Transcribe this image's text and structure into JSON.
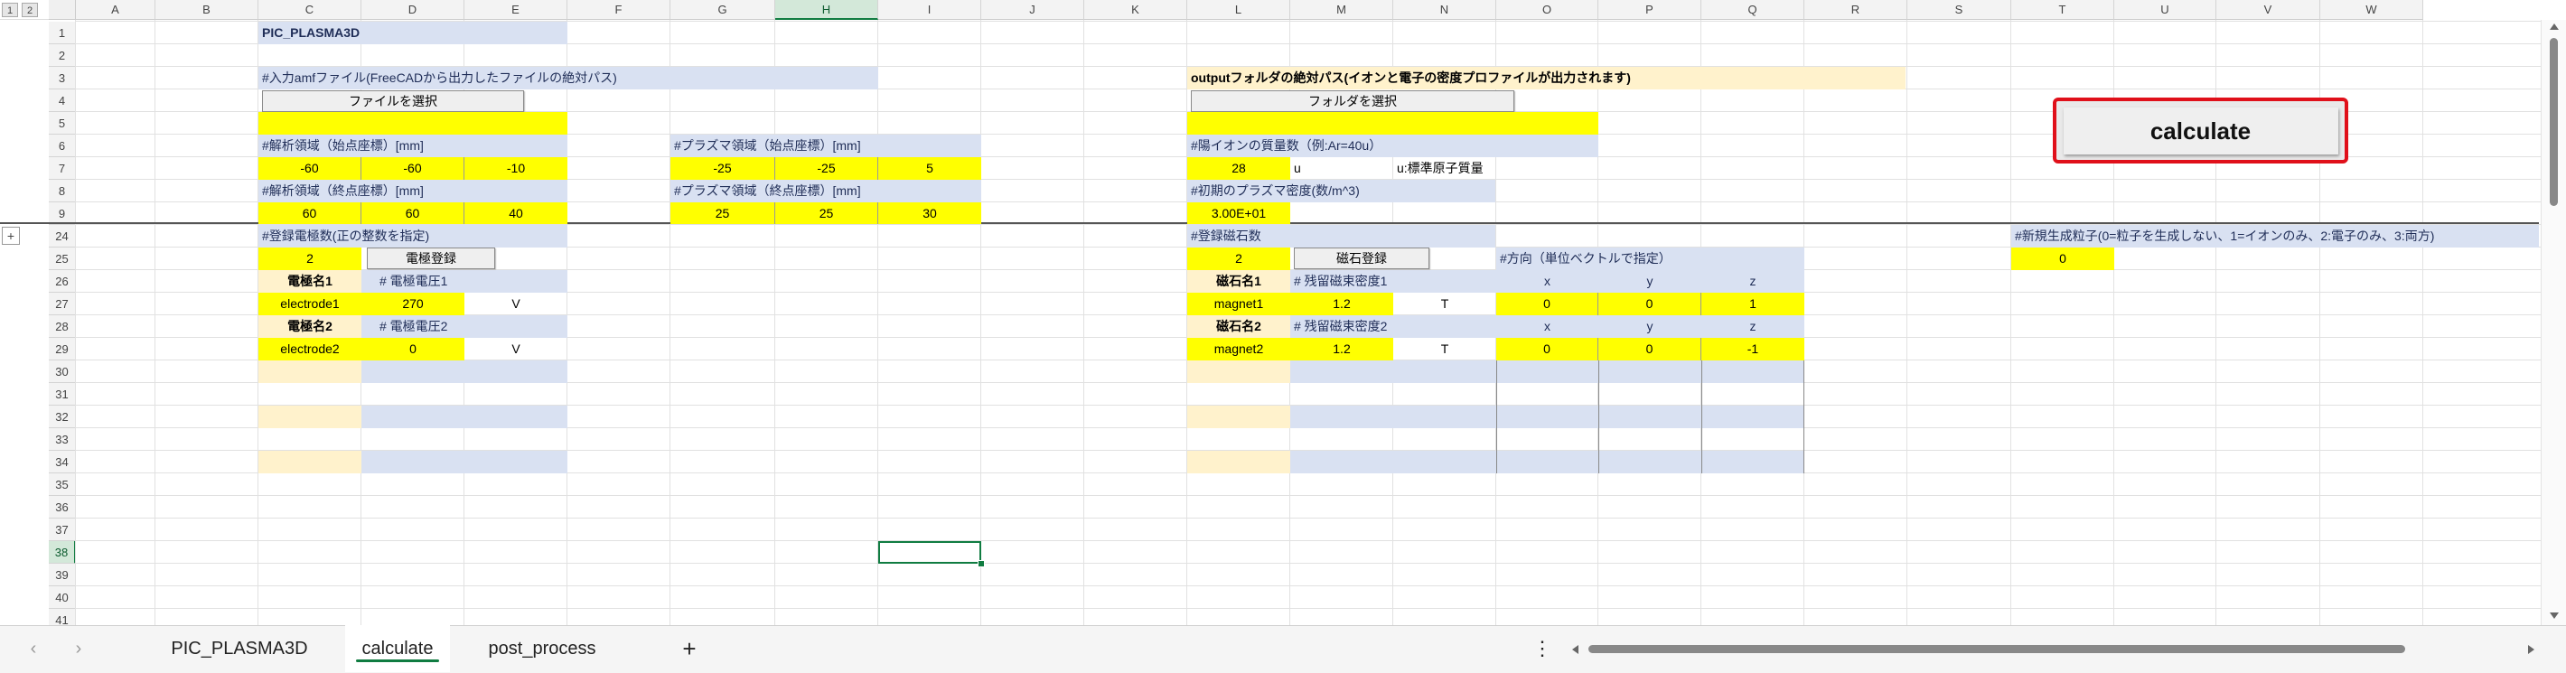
{
  "col_headers": [
    "A",
    "B",
    "C",
    "D",
    "E",
    "F",
    "G",
    "H",
    "I",
    "J",
    "K",
    "L",
    "M",
    "N",
    "O",
    "P",
    "Q",
    "R",
    "S",
    "T",
    "U",
    "V",
    "W"
  ],
  "row_headers": [
    "1",
    "2",
    "3",
    "4",
    "5",
    "6",
    "7",
    "8",
    "9",
    "24",
    "25",
    "26",
    "27",
    "28",
    "29",
    "30",
    "31",
    "32",
    "33",
    "34",
    "35",
    "36",
    "37",
    "38",
    "39",
    "40",
    "41"
  ],
  "outline_levels": [
    "1",
    "2"
  ],
  "expand_label": "+",
  "cells": {
    "title": "PIC_PLASMA3D",
    "amf_label": "#入力amfファイル(FreeCADから出力したファイルの絶対パス)",
    "file_button": "ファイルを選択",
    "output_label": "outputフォルダの絶対パス(イオンと電子の密度プロファイルが出力されます)",
    "folder_button": "フォルダを選択",
    "calculate_button": "calculate",
    "analysis_start_label": "#解析領域（始点座標）[mm]",
    "analysis_start": [
      "-60",
      "-60",
      "-10"
    ],
    "plasma_start_label": "#プラズマ領域（始点座標）[mm]",
    "plasma_start": [
      "-25",
      "-25",
      "5"
    ],
    "ion_mass_label": "#陽イオンの質量数（例:Ar=40u）",
    "ion_mass": "28",
    "ion_mass_unit": "u",
    "ion_mass_note": "u:標準原子質量",
    "analysis_end_label": "#解析領域（終点座標）[mm]",
    "analysis_end": [
      "60",
      "60",
      "40"
    ],
    "plasma_end_label": "#プラズマ領域（終点座標）[mm]",
    "plasma_end": [
      "25",
      "25",
      "30"
    ],
    "plasma_density_label": "#初期のプラズマ密度(数/m^3)",
    "plasma_density": "3.00E+01",
    "electrode_count_label": "#登録電極数(正の整数を指定)",
    "electrode_count": "2",
    "electrode_register_button": "電極登録",
    "magnet_count_label": "#登録磁石数",
    "magnet_count": "2",
    "magnet_register_button": "磁石登録",
    "direction_label": "#方向（単位ベクトルで指定）",
    "new_particle_label": "#新規生成粒子(0=粒子を生成しない、1=イオンのみ、2:電子のみ、3:両方)",
    "new_particle": "0",
    "electrode1_name_label": "電極名1",
    "electrode1_voltage_label": "# 電極電圧1",
    "electrode1_name": "electrode1",
    "electrode1_voltage": "270",
    "electrode1_unit": "V",
    "electrode2_name_label": "電極名2",
    "electrode2_voltage_label": "# 電極電圧2",
    "electrode2_name": "electrode2",
    "electrode2_voltage": "0",
    "electrode2_unit": "V",
    "magnet1_name_label": "磁石名1",
    "magnet1_flux_label": "# 残留磁束密度1",
    "magnet1_name": "magnet1",
    "magnet1_flux": "1.2",
    "magnet1_unit": "T",
    "magnet1_dir": [
      "0",
      "0",
      "1"
    ],
    "magnet2_name_label": "磁石名2",
    "magnet2_flux_label": "# 残留磁束密度2",
    "magnet2_name": "magnet2",
    "magnet2_flux": "1.2",
    "magnet2_unit": "T",
    "magnet2_dir": [
      "0",
      "0",
      "-1"
    ],
    "xyz": [
      "x",
      "y",
      "z"
    ]
  },
  "tabs": [
    "PIC_PLASMA3D",
    "calculate",
    "post_process"
  ],
  "active_tab": "calculate",
  "add_sheet": "+",
  "colors": {
    "label_bg": "#d9e1f2",
    "input_bg": "#ffff00",
    "peach": "#fff2cc",
    "accent": "#107c41",
    "calc_border": "#e0101a"
  }
}
